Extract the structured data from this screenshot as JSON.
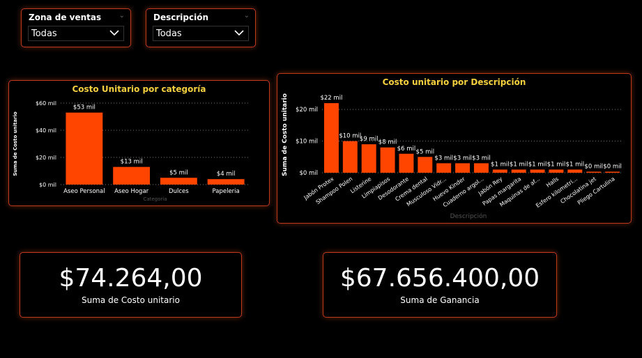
{
  "slicers": [
    {
      "title": "Zona de ventas",
      "value": "Todas"
    },
    {
      "title": "Descripción",
      "value": "Todas"
    }
  ],
  "chart_data": [
    {
      "type": "bar",
      "title": "Costo Unitario por categoría",
      "xlabel": "Categoría",
      "ylabel": "Suma de Costo unitario",
      "categories": [
        "Aseo Personal",
        "Aseo Hogar",
        "Dulces",
        "Papeleria"
      ],
      "values": [
        53,
        13,
        5,
        4
      ],
      "data_labels": [
        "$53 mil",
        "$13 mil",
        "$5 mil",
        "$4 mil"
      ],
      "yticks": [
        0,
        20,
        40,
        60
      ],
      "ytick_labels": [
        "$0 mil",
        "$20 mil",
        "$40 mil",
        "$60 mil"
      ],
      "ylim": [
        0,
        60
      ],
      "grid": true,
      "color": "#ff4500"
    },
    {
      "type": "bar",
      "title": "Costo unitario por Descripción",
      "xlabel": "Descripción",
      "ylabel": "Suma de Costo unitario",
      "categories": [
        "Jabón Protex",
        "Shampoo Polen",
        "Listerine",
        "Limpiapisos",
        "Desodorante",
        "Crema dental",
        "Musculoso Vidr...",
        "Huevo Kinder",
        "Cuaderno argol...",
        "Jabón Rey",
        "Papas margarita",
        "Maquinas de af...",
        "Halls",
        "Esfero kilometri...",
        "Chocolatina jet",
        "Pliego Cartulina"
      ],
      "values": [
        22,
        10,
        9,
        8,
        6,
        5,
        3,
        3,
        3,
        1,
        1,
        1,
        1,
        1,
        0,
        0
      ],
      "data_labels": [
        "$22 mil",
        "$10 mil",
        "$9 mil",
        "$8 mil",
        "$6 mil",
        "$5 mil",
        "$3 mil",
        "$3 mil",
        "$3 mil",
        "$1 mil",
        "$1 mil",
        "$1 mil",
        "$1 mil",
        "$1 mil",
        "$0 mil",
        "$0 mil"
      ],
      "yticks": [
        0,
        10,
        20
      ],
      "ytick_labels": [
        "$0 mil",
        "$10 mil",
        "$20 mil"
      ],
      "ylim": [
        0,
        24
      ],
      "grid": true,
      "color": "#ff4500"
    }
  ],
  "kpis": [
    {
      "value": "$74.264,00",
      "label": "Suma de Costo unitario"
    },
    {
      "value": "$67.656.400,00",
      "label": "Suma de Ganancia"
    }
  ]
}
